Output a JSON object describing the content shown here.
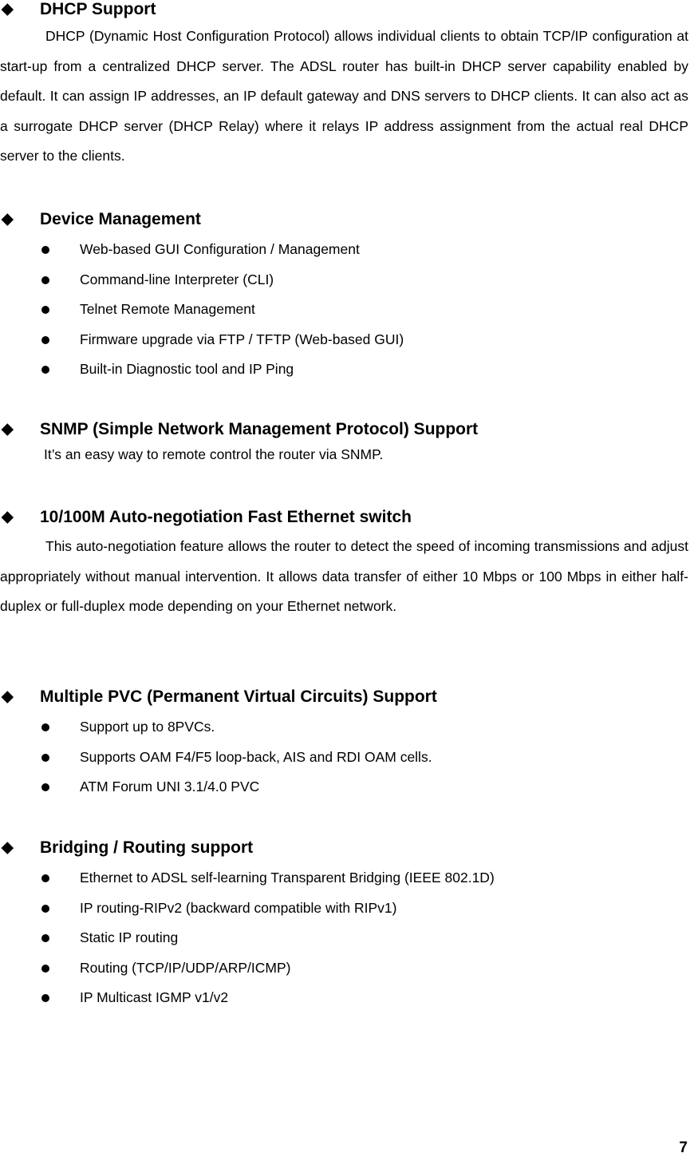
{
  "sections": {
    "dhcp": {
      "icon": "◆",
      "title": "DHCP Support",
      "paragraph": "DHCP (Dynamic Host Configuration Protocol) allows individual clients to obtain TCP/IP configuration at start-up from a centralized DHCP server. The ADSL router has built-in DHCP server capability enabled by default. It can assign IP addresses, an IP default gateway and DNS servers to DHCP clients. It can also act as a surrogate DHCP server (DHCP Relay) where it relays IP address assignment from the actual real DHCP server to the clients."
    },
    "device_management": {
      "icon": "◆",
      "title": "Device Management",
      "items": [
        "Web-based GUI Configuration / Management",
        "Command-line Interpreter (CLI)",
        "Telnet Remote Management",
        "Firmware upgrade via FTP / TFTP (Web-based GUI)",
        "Built-in Diagnostic tool and IP Ping"
      ]
    },
    "snmp": {
      "icon": "◆",
      "title": "SNMP (Simple Network Management Protocol) Support",
      "paragraph": "It’s an easy way to remote control the router via SNMP."
    },
    "ethernet": {
      "icon": "◆",
      "title": "10/100M Auto-negotiation Fast Ethernet switch",
      "paragraph": "This auto-negotiation feature allows the router to detect the speed of incoming transmissions and adjust appropriately without manual intervention. It allows data transfer of either 10 Mbps or 100 Mbps in either half-duplex or full-duplex mode depending on your Ethernet network."
    },
    "pvc": {
      "icon": "◆",
      "title": "Multiple PVC (Permanent Virtual Circuits) Support",
      "items": [
        "Support up to 8PVCs.",
        "Supports OAM F4/F5 loop-back, AIS and RDI OAM cells.",
        "ATM Forum UNI 3.1/4.0 PVC"
      ]
    },
    "bridging": {
      "icon": "◆",
      "title": "Bridging / Routing support",
      "items": [
        "Ethernet to ADSL self-learning Transparent Bridging (IEEE 802.1D)",
        "IP routing-RIPv2 (backward compatible with RIPv1)",
        "Static IP routing",
        "Routing (TCP/IP/UDP/ARP/ICMP)",
        "IP Multicast IGMP v1/v2"
      ]
    }
  },
  "page_number": "7"
}
